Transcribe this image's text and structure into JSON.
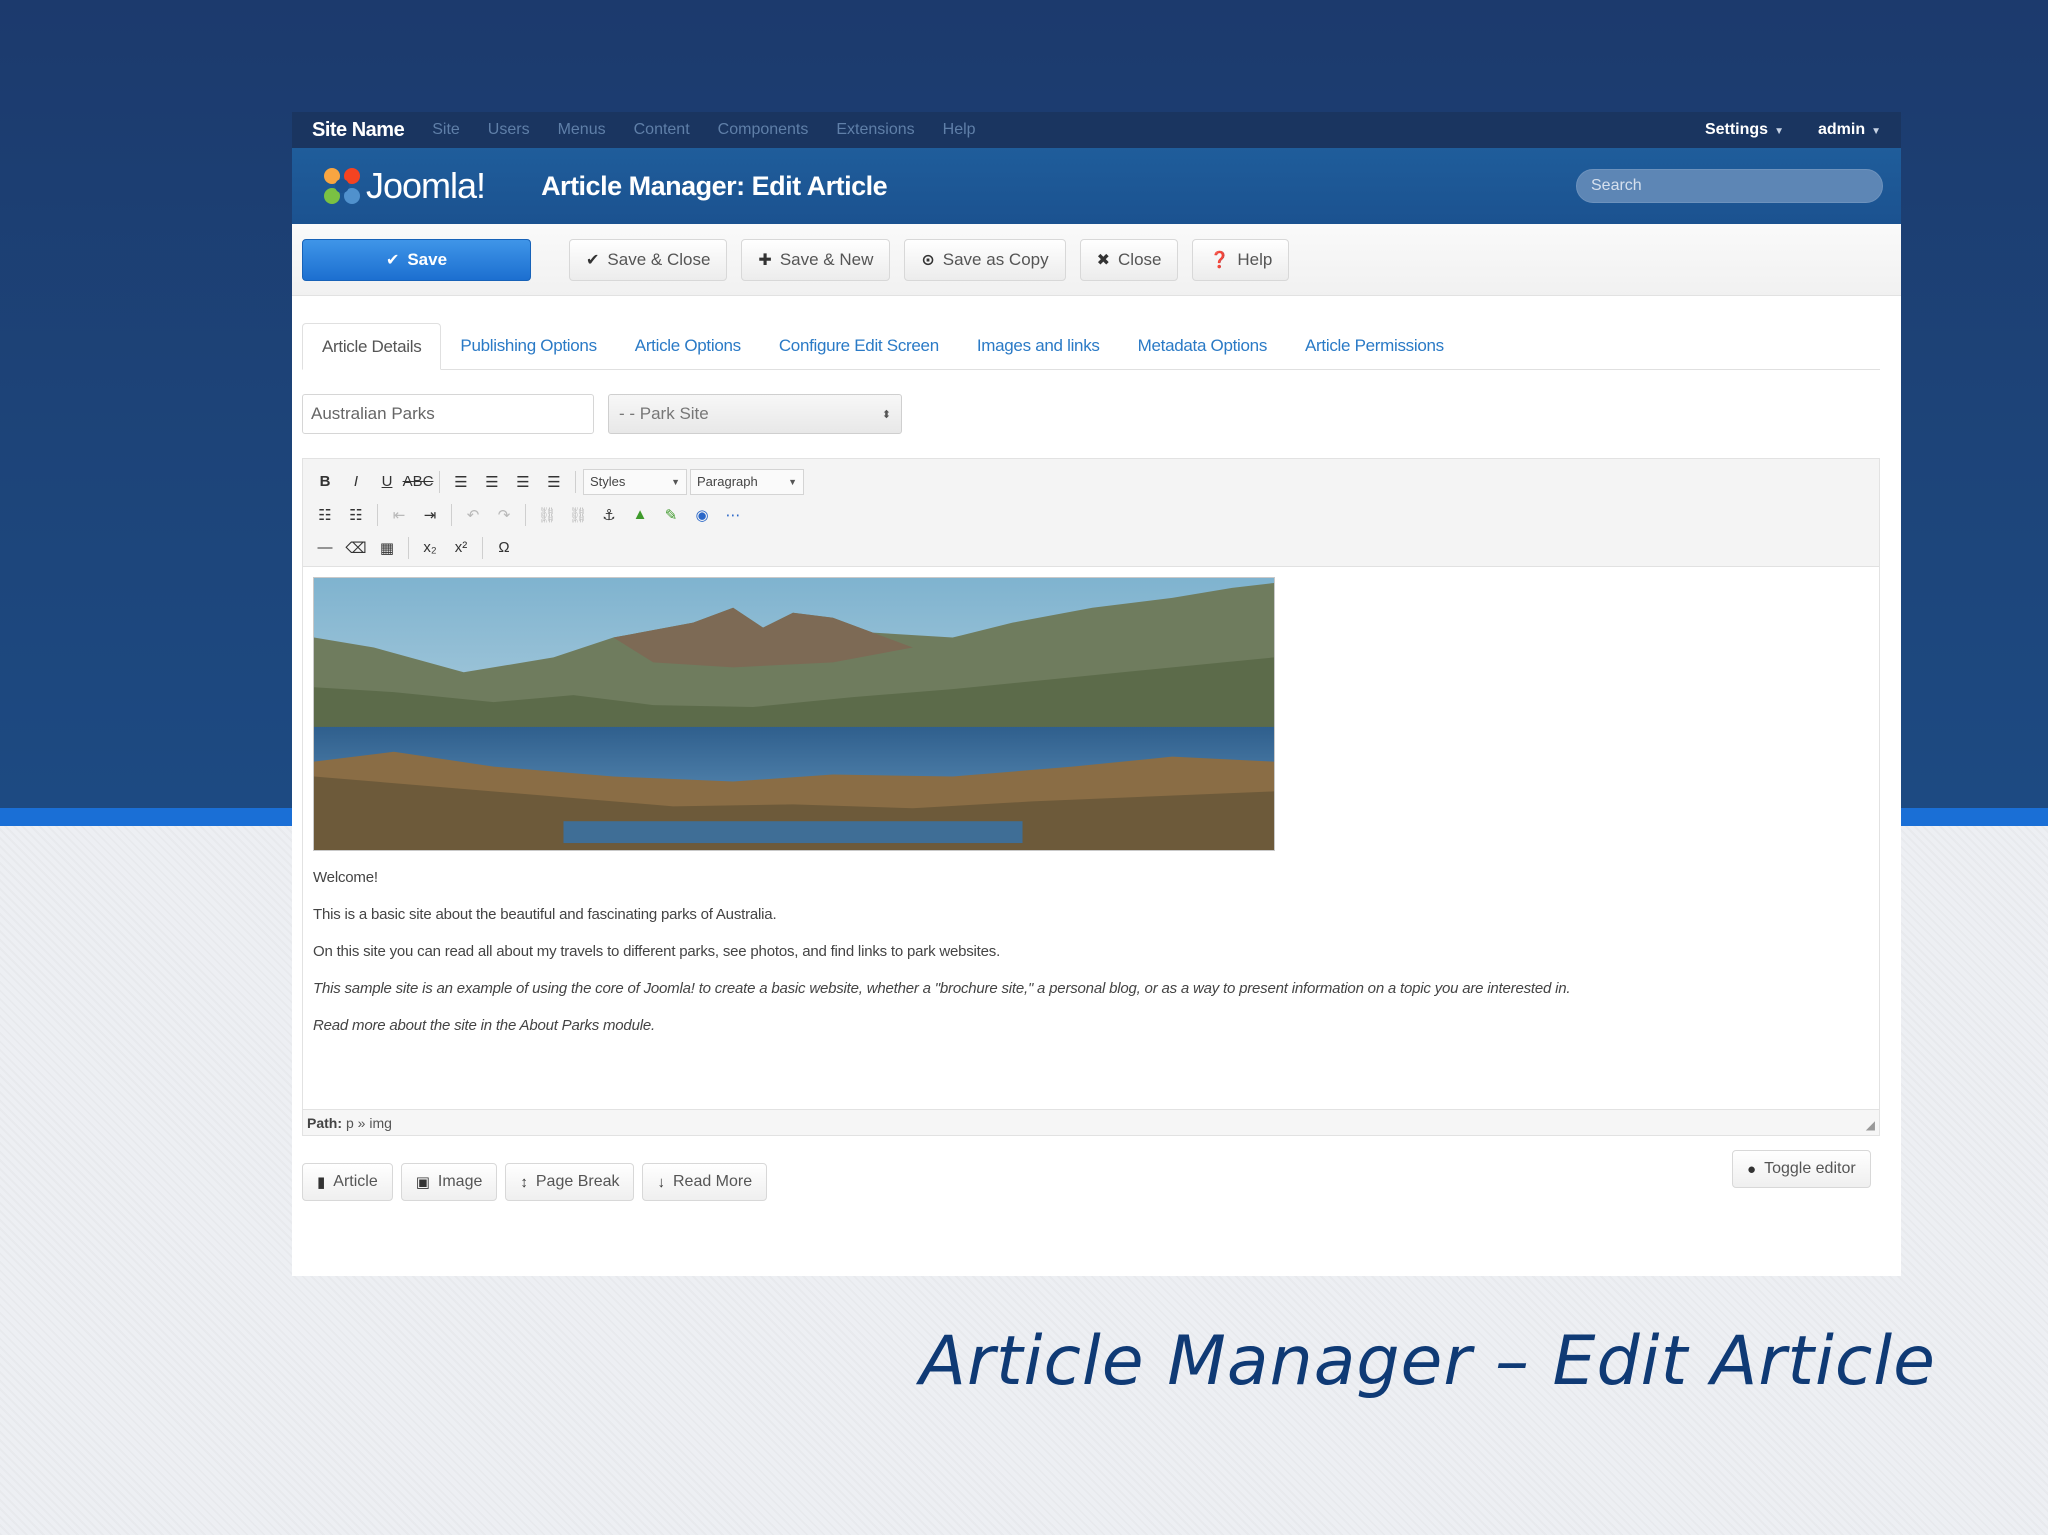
{
  "caption": "Article Manager – Edit Article",
  "topnav": {
    "site_name": "Site Name",
    "items": [
      "Site",
      "Users",
      "Menus",
      "Content",
      "Components",
      "Extensions",
      "Help"
    ],
    "settings": "Settings",
    "admin": "admin"
  },
  "header": {
    "logo_text": "Joomla!",
    "title": "Article Manager: Edit Article",
    "search_placeholder": "Search"
  },
  "toolbar": {
    "save": "Save",
    "save_close": "Save & Close",
    "save_new": "Save & New",
    "save_copy": "Save as Copy",
    "close": "Close",
    "help": "Help"
  },
  "tabs": [
    "Article Details",
    "Publishing Options",
    "Article Options",
    "Configure Edit Screen",
    "Images and links",
    "Metadata Options",
    "Article Permissions"
  ],
  "form": {
    "title_value": "Australian Parks",
    "parent_value": "- - Park Site"
  },
  "editor": {
    "styles_label": "Styles",
    "paragraph_label": "Paragraph",
    "paragraphs": [
      "Welcome!",
      "This is a basic site about the beautiful and fascinating parks of Australia.",
      "On this site you can read all about my travels to different parks, see photos, and find links to park websites.",
      "This sample site is an example of using the core of Joomla! to create a basic website, whether a \"brochure site,\"  a personal blog, or as a way to present information on a topic you are interested in.",
      "Read more about the site in the About Parks module."
    ],
    "path_label": "Path:",
    "path_value": "p » img"
  },
  "extra_buttons": {
    "article": "Article",
    "image": "Image",
    "page_break": "Page Break",
    "read_more": "Read More",
    "toggle_editor": "Toggle editor"
  },
  "colors": {
    "primary": "#1c6fd0",
    "header": "#1b5290",
    "topnav": "#1a3560",
    "link": "#2a7ac6"
  }
}
